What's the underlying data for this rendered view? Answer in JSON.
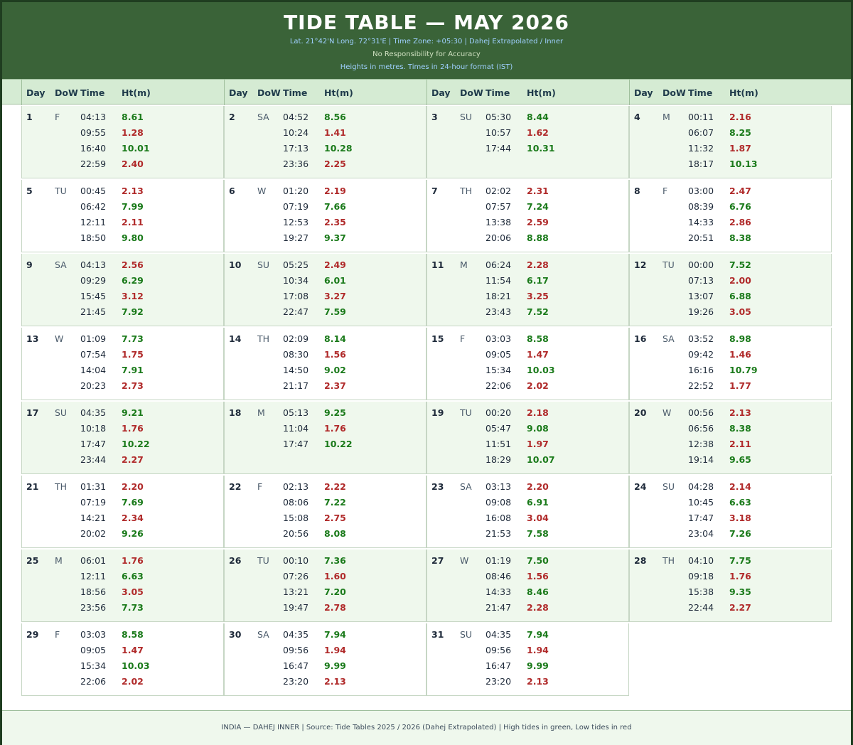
{
  "header": {
    "title": "TIDE TABLE — MAY 2026",
    "meta": "Lat. 21°42'N  Long. 72°31'E   |   Time Zone: +05:30   |   Dahej Extrapolated / Inner",
    "disclaimer": "No Responsibility for Accuracy",
    "units": "Heights in metres.  Times in 24-hour format (IST)"
  },
  "columns": {
    "day": "Day",
    "dow": "DoW",
    "time": "Time",
    "height": "Ht(m)"
  },
  "days": [
    {
      "day": "1",
      "dow": "F",
      "tides": [
        [
          "04:13",
          "8.61",
          "hi"
        ],
        [
          "09:55",
          "1.28",
          "lo"
        ],
        [
          "16:40",
          "10.01",
          "hi"
        ],
        [
          "22:59",
          "2.40",
          "lo"
        ]
      ]
    },
    {
      "day": "2",
      "dow": "SA",
      "tides": [
        [
          "04:52",
          "8.56",
          "hi"
        ],
        [
          "10:24",
          "1.41",
          "lo"
        ],
        [
          "17:13",
          "10.28",
          "hi"
        ],
        [
          "23:36",
          "2.25",
          "lo"
        ]
      ]
    },
    {
      "day": "3",
      "dow": "SU",
      "tides": [
        [
          "05:30",
          "8.44",
          "hi"
        ],
        [
          "10:57",
          "1.62",
          "lo"
        ],
        [
          "17:44",
          "10.31",
          "hi"
        ]
      ]
    },
    {
      "day": "4",
      "dow": "M",
      "tides": [
        [
          "00:11",
          "2.16",
          "lo"
        ],
        [
          "06:07",
          "8.25",
          "hi"
        ],
        [
          "11:32",
          "1.87",
          "lo"
        ],
        [
          "18:17",
          "10.13",
          "hi"
        ]
      ]
    },
    {
      "day": "5",
      "dow": "TU",
      "tides": [
        [
          "00:45",
          "2.13",
          "lo"
        ],
        [
          "06:42",
          "7.99",
          "hi"
        ],
        [
          "12:11",
          "2.11",
          "lo"
        ],
        [
          "18:50",
          "9.80",
          "hi"
        ]
      ]
    },
    {
      "day": "6",
      "dow": "W",
      "tides": [
        [
          "01:20",
          "2.19",
          "lo"
        ],
        [
          "07:19",
          "7.66",
          "hi"
        ],
        [
          "12:53",
          "2.35",
          "lo"
        ],
        [
          "19:27",
          "9.37",
          "hi"
        ]
      ]
    },
    {
      "day": "7",
      "dow": "TH",
      "tides": [
        [
          "02:02",
          "2.31",
          "lo"
        ],
        [
          "07:57",
          "7.24",
          "hi"
        ],
        [
          "13:38",
          "2.59",
          "lo"
        ],
        [
          "20:06",
          "8.88",
          "hi"
        ]
      ]
    },
    {
      "day": "8",
      "dow": "F",
      "tides": [
        [
          "03:00",
          "2.47",
          "lo"
        ],
        [
          "08:39",
          "6.76",
          "hi"
        ],
        [
          "14:33",
          "2.86",
          "lo"
        ],
        [
          "20:51",
          "8.38",
          "hi"
        ]
      ]
    },
    {
      "day": "9",
      "dow": "SA",
      "tides": [
        [
          "04:13",
          "2.56",
          "lo"
        ],
        [
          "09:29",
          "6.29",
          "hi"
        ],
        [
          "15:45",
          "3.12",
          "lo"
        ],
        [
          "21:45",
          "7.92",
          "hi"
        ]
      ]
    },
    {
      "day": "10",
      "dow": "SU",
      "tides": [
        [
          "05:25",
          "2.49",
          "lo"
        ],
        [
          "10:34",
          "6.01",
          "hi"
        ],
        [
          "17:08",
          "3.27",
          "lo"
        ],
        [
          "22:47",
          "7.59",
          "hi"
        ]
      ]
    },
    {
      "day": "11",
      "dow": "M",
      "tides": [
        [
          "06:24",
          "2.28",
          "lo"
        ],
        [
          "11:54",
          "6.17",
          "hi"
        ],
        [
          "18:21",
          "3.25",
          "lo"
        ],
        [
          "23:43",
          "7.52",
          "hi"
        ]
      ]
    },
    {
      "day": "12",
      "dow": "TU",
      "tides": [
        [
          "00:00",
          "7.52",
          "hi"
        ],
        [
          "07:13",
          "2.00",
          "lo"
        ],
        [
          "13:07",
          "6.88",
          "hi"
        ],
        [
          "19:26",
          "3.05",
          "lo"
        ]
      ]
    },
    {
      "day": "13",
      "dow": "W",
      "tides": [
        [
          "01:09",
          "7.73",
          "hi"
        ],
        [
          "07:54",
          "1.75",
          "lo"
        ],
        [
          "14:04",
          "7.91",
          "hi"
        ],
        [
          "20:23",
          "2.73",
          "lo"
        ]
      ]
    },
    {
      "day": "14",
      "dow": "TH",
      "tides": [
        [
          "02:09",
          "8.14",
          "hi"
        ],
        [
          "08:30",
          "1.56",
          "lo"
        ],
        [
          "14:50",
          "9.02",
          "hi"
        ],
        [
          "21:17",
          "2.37",
          "lo"
        ]
      ]
    },
    {
      "day": "15",
      "dow": "F",
      "tides": [
        [
          "03:03",
          "8.58",
          "hi"
        ],
        [
          "09:05",
          "1.47",
          "lo"
        ],
        [
          "15:34",
          "10.03",
          "hi"
        ],
        [
          "22:06",
          "2.02",
          "lo"
        ]
      ]
    },
    {
      "day": "16",
      "dow": "SA",
      "tides": [
        [
          "03:52",
          "8.98",
          "hi"
        ],
        [
          "09:42",
          "1.46",
          "lo"
        ],
        [
          "16:16",
          "10.79",
          "hi"
        ],
        [
          "22:52",
          "1.77",
          "lo"
        ]
      ]
    },
    {
      "day": "17",
      "dow": "SU",
      "tides": [
        [
          "04:35",
          "9.21",
          "hi"
        ],
        [
          "10:18",
          "1.76",
          "lo"
        ],
        [
          "17:47",
          "10.22",
          "hi"
        ],
        [
          "23:44",
          "2.27",
          "lo"
        ]
      ]
    },
    {
      "day": "18",
      "dow": "M",
      "tides": [
        [
          "05:13",
          "9.25",
          "hi"
        ],
        [
          "11:04",
          "1.76",
          "lo"
        ],
        [
          "17:47",
          "10.22",
          "hi"
        ]
      ]
    },
    {
      "day": "19",
      "dow": "TU",
      "tides": [
        [
          "00:20",
          "2.18",
          "lo"
        ],
        [
          "05:47",
          "9.08",
          "hi"
        ],
        [
          "11:51",
          "1.97",
          "lo"
        ],
        [
          "18:29",
          "10.07",
          "hi"
        ]
      ]
    },
    {
      "day": "20",
      "dow": "W",
      "tides": [
        [
          "00:56",
          "2.13",
          "lo"
        ],
        [
          "06:56",
          "8.38",
          "hi"
        ],
        [
          "12:38",
          "2.11",
          "lo"
        ],
        [
          "19:14",
          "9.65",
          "hi"
        ]
      ]
    },
    {
      "day": "21",
      "dow": "TH",
      "tides": [
        [
          "01:31",
          "2.20",
          "lo"
        ],
        [
          "07:19",
          "7.69",
          "hi"
        ],
        [
          "14:21",
          "2.34",
          "lo"
        ],
        [
          "20:02",
          "9.26",
          "hi"
        ]
      ]
    },
    {
      "day": "22",
      "dow": "F",
      "tides": [
        [
          "02:13",
          "2.22",
          "lo"
        ],
        [
          "08:06",
          "7.22",
          "hi"
        ],
        [
          "15:08",
          "2.75",
          "lo"
        ],
        [
          "20:56",
          "8.08",
          "hi"
        ]
      ]
    },
    {
      "day": "23",
      "dow": "SA",
      "tides": [
        [
          "03:13",
          "2.20",
          "lo"
        ],
        [
          "09:08",
          "6.91",
          "hi"
        ],
        [
          "16:08",
          "3.04",
          "lo"
        ],
        [
          "21:53",
          "7.58",
          "hi"
        ]
      ]
    },
    {
      "day": "24",
      "dow": "SU",
      "tides": [
        [
          "04:28",
          "2.14",
          "lo"
        ],
        [
          "10:45",
          "6.63",
          "hi"
        ],
        [
          "17:47",
          "3.18",
          "lo"
        ],
        [
          "23:04",
          "7.26",
          "hi"
        ]
      ]
    },
    {
      "day": "25",
      "dow": "M",
      "tides": [
        [
          "06:01",
          "1.76",
          "lo"
        ],
        [
          "12:11",
          "6.63",
          "hi"
        ],
        [
          "18:56",
          "3.05",
          "lo"
        ],
        [
          "23:56",
          "7.73",
          "hi"
        ]
      ]
    },
    {
      "day": "26",
      "dow": "TU",
      "tides": [
        [
          "00:10",
          "7.36",
          "hi"
        ],
        [
          "07:26",
          "1.60",
          "lo"
        ],
        [
          "13:21",
          "7.20",
          "hi"
        ],
        [
          "19:47",
          "2.78",
          "lo"
        ]
      ]
    },
    {
      "day": "27",
      "dow": "W",
      "tides": [
        [
          "01:19",
          "7.50",
          "hi"
        ],
        [
          "08:46",
          "1.56",
          "lo"
        ],
        [
          "14:33",
          "8.46",
          "hi"
        ],
        [
          "21:47",
          "2.28",
          "lo"
        ]
      ]
    },
    {
      "day": "28",
      "dow": "TH",
      "tides": [
        [
          "04:10",
          "7.75",
          "hi"
        ],
        [
          "09:18",
          "1.76",
          "lo"
        ],
        [
          "15:38",
          "9.35",
          "hi"
        ],
        [
          "22:44",
          "2.27",
          "lo"
        ]
      ]
    },
    {
      "day": "29",
      "dow": "F",
      "tides": [
        [
          "03:03",
          "8.58",
          "hi"
        ],
        [
          "09:05",
          "1.47",
          "lo"
        ],
        [
          "15:34",
          "10.03",
          "hi"
        ],
        [
          "22:06",
          "2.02",
          "lo"
        ]
      ]
    },
    {
      "day": "30",
      "dow": "SA",
      "tides": [
        [
          "04:35",
          "7.94",
          "hi"
        ],
        [
          "09:56",
          "1.94",
          "lo"
        ],
        [
          "16:47",
          "9.99",
          "hi"
        ],
        [
          "23:20",
          "2.13",
          "lo"
        ]
      ]
    },
    {
      "day": "31",
      "dow": "SU",
      "tides": [
        [
          "04:35",
          "7.94",
          "hi"
        ],
        [
          "09:56",
          "1.94",
          "lo"
        ],
        [
          "16:47",
          "9.99",
          "hi"
        ],
        [
          "23:20",
          "2.13",
          "lo"
        ]
      ]
    }
  ],
  "colors": {
    "high": "#1a7a1a",
    "low": "#b02a2a",
    "header_bg": "#3a6338"
  },
  "footer": {
    "text": "INDIA — DAHEJ INNER   |   Source: Tide Tables 2025 / 2026 (Dahej Extrapolated)   |   High tides in green, Low tides in red"
  }
}
